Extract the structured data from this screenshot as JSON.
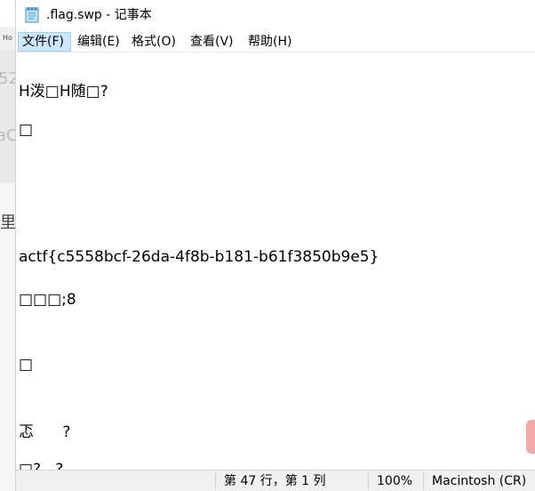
{
  "background_window": {
    "snippet_1": "Ho",
    "snippet_2": "52",
    "snippet_3": "aC",
    "snippet_4": "里"
  },
  "window": {
    "title": ".flag.swp - 记事本",
    "icon": "notepad-icon"
  },
  "menu": [
    {
      "label": "文件(F)",
      "active": true
    },
    {
      "label": "编辑(E)",
      "active": false
    },
    {
      "label": "格式(O)",
      "active": false
    },
    {
      "label": "查看(V)",
      "active": false
    },
    {
      "label": "帮助(H)",
      "active": false
    }
  ],
  "editor": {
    "lines": [
      "H泼□H随□?",
      "□",
      "actf{c5558bcf-26da-4f8b-b181-b61f3850b9e5}",
      "□□□;8",
      "□",
      "忑      ?",
      "□?   ?"
    ]
  },
  "statusbar": {
    "position": "第 47 行，第 1 列",
    "zoom": "100%",
    "line_ending": "Macintosh (CR)"
  },
  "colors": {
    "menu_active_bg": "#cce8ff",
    "menu_active_border": "#99d1ff",
    "statusbar_bg": "#f0f0f0",
    "scroll_tab": "#f4a8a8"
  }
}
